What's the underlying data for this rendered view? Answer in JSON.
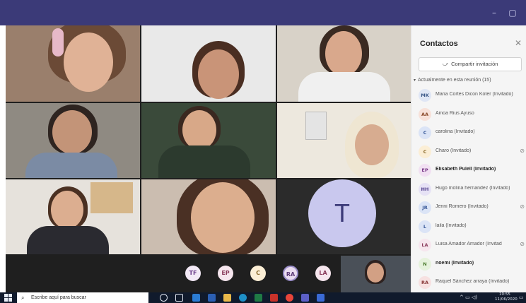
{
  "window": {
    "minimize_icon": "minimize-icon",
    "maximize_icon": "maximize-icon"
  },
  "stage": {
    "tile_t_initial": "T",
    "bottom_avatars": [
      {
        "initials": "TF",
        "bg": "#f3e9f6",
        "fg": "#6b3b8a"
      },
      {
        "initials": "EP",
        "bg": "#f6e6ee",
        "fg": "#8a3b5c"
      },
      {
        "initials": "C",
        "bg": "#fbeed5",
        "fg": "#8a6a2b"
      },
      {
        "initials": "RA",
        "bg": "#eadcf0",
        "fg": "#5d3b78"
      },
      {
        "initials": "LA",
        "bg": "#f6e6ee",
        "fg": "#8a3b5c"
      }
    ]
  },
  "panel": {
    "title": "Contactos",
    "share_label": "Compartir invitación",
    "section_label": "Actualmente en esta reunión (15)",
    "participants": [
      {
        "initials": "MK",
        "name": "Maria Cortes Dicon Koter (Invitado)",
        "bold": false,
        "muted": false,
        "bg": "#dfe6f5",
        "fg": "#3d5a8a"
      },
      {
        "initials": "AA",
        "name": "Ainoa Rius Ayuso",
        "bold": false,
        "muted": false,
        "bg": "#f7e1d9",
        "fg": "#8a4a2b"
      },
      {
        "initials": "C",
        "name": "carolina (Invitado)",
        "bold": false,
        "muted": false,
        "bg": "#dbe4f6",
        "fg": "#3a5a9a"
      },
      {
        "initials": "C",
        "name": "Charo (Invitado)",
        "bold": false,
        "muted": true,
        "bg": "#fbeed5",
        "fg": "#8a6a2b"
      },
      {
        "initials": "EP",
        "name": "Elisabeth Pulell (Invitado)",
        "bold": true,
        "muted": false,
        "bg": "#f1e0f2",
        "fg": "#7a3b8a"
      },
      {
        "initials": "HH",
        "name": "Hugo molina hernandez (Invitado)",
        "bold": false,
        "muted": false,
        "bg": "#e6e2f5",
        "fg": "#4d3b8a"
      },
      {
        "initials": "JR",
        "name": "Jenni Romero (Invitado)",
        "bold": false,
        "muted": true,
        "bg": "#dbe4f6",
        "fg": "#3a5a9a"
      },
      {
        "initials": "L",
        "name": "laila (Invitado)",
        "bold": false,
        "muted": false,
        "bg": "#dbe4f6",
        "fg": "#3a5a9a"
      },
      {
        "initials": "LA",
        "name": "Luisa Amador Amador (Invitad",
        "bold": false,
        "muted": true,
        "bg": "#f6e6ee",
        "fg": "#8a3b5c"
      },
      {
        "initials": "N",
        "name": "noemi (Invitado)",
        "bold": true,
        "muted": false,
        "bg": "#e6f2dc",
        "fg": "#4a7a2b"
      },
      {
        "initials": "RA",
        "name": "Raquel Sánchez arraya (Invitado)",
        "bold": false,
        "muted": false,
        "bg": "#f7e1e1",
        "fg": "#8a3b3b"
      }
    ],
    "close_icon": "close-icon",
    "mic_off_icon": "mic-off-icon"
  },
  "taskbar": {
    "search_placeholder": "Escribe aquí para buscar",
    "time": "10:55",
    "date": "11/06/2020"
  },
  "colors": {
    "titlebar": "#3b3a78",
    "panel_bg": "#f5f5f5",
    "taskbar": "#101a2c",
    "t_avatar_bg": "#c9c8ee",
    "t_avatar_fg": "#3b3a78"
  }
}
